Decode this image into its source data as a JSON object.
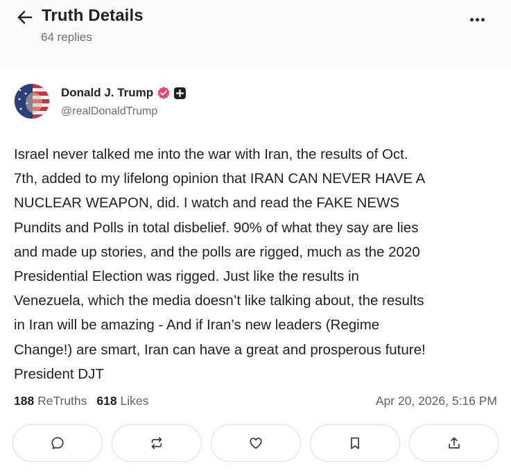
{
  "header": {
    "title": "Truth Details",
    "replies": "64 replies",
    "back_icon": "arrow-left-icon",
    "more_icon": "more-horizontal-icon"
  },
  "author": {
    "name": "Donald J. Trump",
    "handle": "@realDonaldTrump",
    "verified_color": "#e8456f"
  },
  "post": {
    "text": "Israel never talked me into the war with Iran, the results of Oct.\n7th, added to my lifelong opinion that IRAN CAN NEVER HAVE A\nNUCLEAR WEAPON, did. I watch and read the FAKE NEWS\nPundits and Polls in total disbelief. 90% of what they say are lies\nand made up stories, and the polls are rigged, much as the 2020\nPresidential Election was rigged. Just like the results in\nVenezuela, which the media doesn’t like talking about, the results\nin Iran will be amazing - And if Iran’s new leaders (Regime\nChange!) are smart, Iran can have a great and prosperous future!\nPresident DJT"
  },
  "stats": {
    "retruths_count": "188",
    "retruths_label": "ReTruths",
    "likes_count": "618",
    "likes_label": "Likes",
    "timestamp": "Apr 20, 2026, 5:16 PM"
  },
  "actions": [
    {
      "name": "reply",
      "icon": "comment-icon"
    },
    {
      "name": "retruth",
      "icon": "repost-icon"
    },
    {
      "name": "like",
      "icon": "heart-icon"
    },
    {
      "name": "bookmark",
      "icon": "bookmark-icon"
    },
    {
      "name": "share",
      "icon": "share-icon"
    }
  ]
}
